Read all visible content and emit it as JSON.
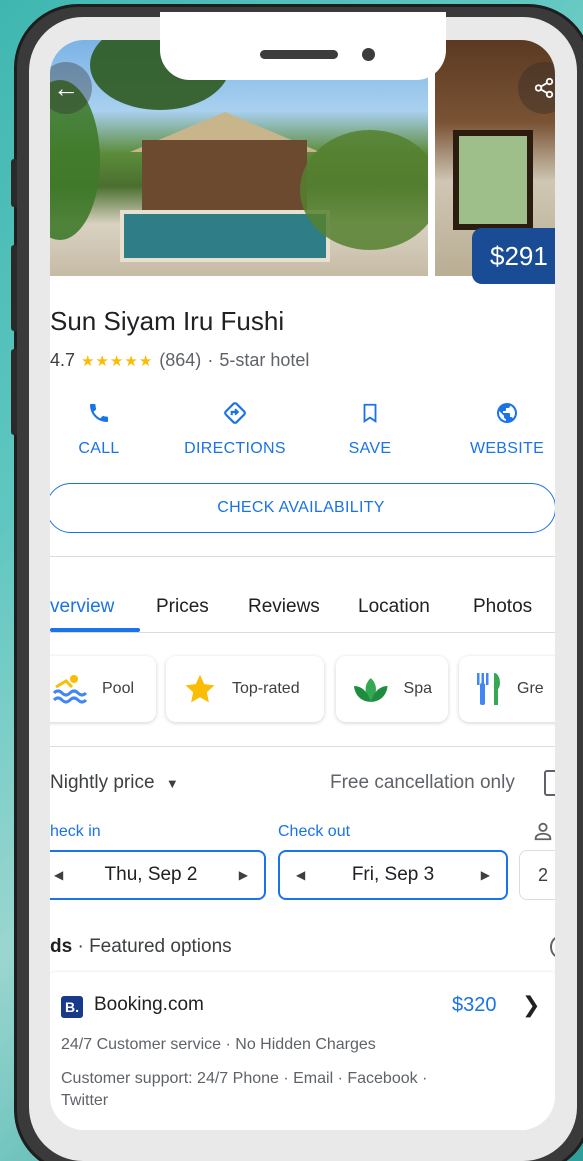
{
  "hotel": {
    "name": "Sun Siyam Iru Fushi",
    "rating": "4.7",
    "stars": "★★★★★",
    "reviews": "(864)",
    "separator": "·",
    "category": "5-star hotel",
    "price_badge": "$291"
  },
  "actions": [
    {
      "label": "CALL",
      "icon": "phone-icon"
    },
    {
      "label": "DIRECTIONS",
      "icon": "directions-icon"
    },
    {
      "label": "SAVE",
      "icon": "bookmark-icon"
    },
    {
      "label": "WEBSITE",
      "icon": "globe-icon"
    }
  ],
  "check_availability": "CHECK AVAILABILITY",
  "tabs": [
    {
      "label": "verview",
      "active": true
    },
    {
      "label": "Prices",
      "active": false
    },
    {
      "label": "Reviews",
      "active": false
    },
    {
      "label": "Location",
      "active": false
    },
    {
      "label": "Photos",
      "active": false
    }
  ],
  "amenities": [
    {
      "label": "Pool",
      "icon": "pool-icon"
    },
    {
      "label": "Top-rated",
      "icon": "star-icon"
    },
    {
      "label": "Spa",
      "icon": "spa-icon"
    },
    {
      "label": "Gre",
      "icon": "restaurant-icon"
    }
  ],
  "pricing": {
    "nightly": "Nightly price",
    "free_cancel": "Free cancellation only",
    "check_in_label": "heck in",
    "check_in_value": "Thu, Sep 2",
    "check_out_label": "Check out",
    "check_out_value": "Fri, Sep 3",
    "guests": "2",
    "featured_prefix": "ds",
    "featured": " · Featured options"
  },
  "offer": {
    "logo": "B.",
    "site": "Booking.com",
    "price": "$320",
    "line1": "24/7 Customer service · No Hidden Charges",
    "line2": "Customer support: 24/7 Phone · Email · Facebook · Twitter"
  },
  "colors": {
    "accent": "#1a73e8",
    "badge": "#1a4c95",
    "star": "#fbbc04"
  }
}
